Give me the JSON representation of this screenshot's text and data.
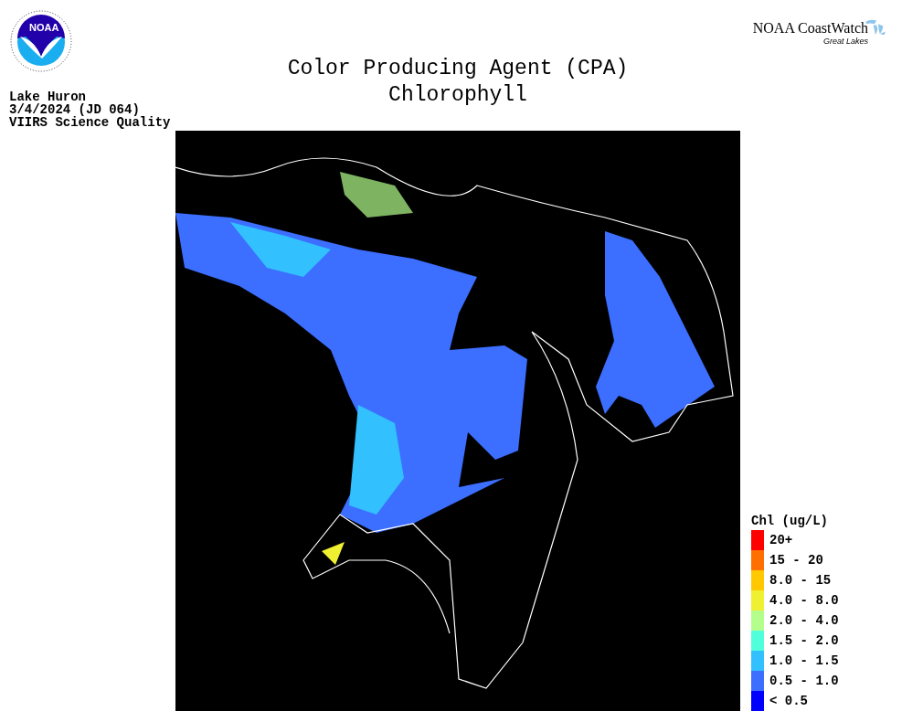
{
  "logos": {
    "agency_mark": "NOAA",
    "brand": "NOAA CoastWatch",
    "brand_subtitle": "Great Lakes"
  },
  "title": [
    "Color Producing Agent (CPA)",
    "Chlorophyll"
  ],
  "info": [
    "Lake Huron",
    "3/4/2024 (JD 064)",
    "VIIRS Science Quality"
  ],
  "legend": {
    "title": "Chl (ug/L)",
    "items": [
      {
        "label": "20+",
        "color": "#ff0000"
      },
      {
        "label": "15 - 20",
        "color": "#ff7000"
      },
      {
        "label": "8.0 - 15",
        "color": "#ffc800"
      },
      {
        "label": "4.0 - 8.0",
        "color": "#f0f032"
      },
      {
        "label": "2.0 - 4.0",
        "color": "#b4ff8c"
      },
      {
        "label": "1.5 - 2.0",
        "color": "#50ffdc"
      },
      {
        "label": "1.0 - 1.5",
        "color": "#32c0ff"
      },
      {
        "label": "0.5 - 1.0",
        "color": "#3c6eff"
      },
      {
        "label": "< 0.5",
        "color": "#0000ff"
      }
    ]
  }
}
